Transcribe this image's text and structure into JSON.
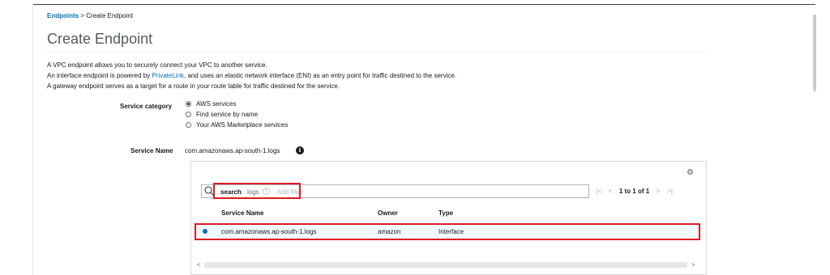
{
  "breadcrumb": {
    "link": "Endpoints",
    "separator": ">",
    "current": "Create Endpoint"
  },
  "page_title": "Create Endpoint",
  "description": {
    "line1": "A VPC endpoint allows you to securely connect your VPC to another service.",
    "line2_before": "An interface endpoint is powered by",
    "line2_link": "PrivateLink",
    "line2_after": ", and uses an elastic network interface (ENI) as an entry point for traffic destined to the service.",
    "line3": "A gateway endpoint serves as a target for a route in your route table for traffic destined for the service."
  },
  "service_category": {
    "label": "Service category",
    "options": [
      {
        "label": "AWS services",
        "selected": true
      },
      {
        "label": "Find service by name",
        "selected": false
      },
      {
        "label": "Your AWS Marketplace services",
        "selected": false
      }
    ]
  },
  "service_name": {
    "label": "Service Name",
    "value": "com.amazonaws.ap-south-1.logs"
  },
  "filter": {
    "token_key": "search",
    "token_separator": ":",
    "token_value": "logs",
    "placeholder": "Add filter"
  },
  "pagination": {
    "text": "1 to 1 of 1"
  },
  "table": {
    "columns": [
      "Service Name",
      "Owner",
      "Type"
    ],
    "rows": [
      {
        "service_name": "com.amazonaws.ap-south-1.logs",
        "owner": "amazon",
        "type": "Interface",
        "selected": true
      }
    ]
  },
  "colors": {
    "link": "#0073bb",
    "highlight": "#e01b24",
    "selected_row": "#f1faff"
  },
  "icons": {
    "info": "info-icon",
    "settings": "gear-icon",
    "search": "search-icon"
  }
}
